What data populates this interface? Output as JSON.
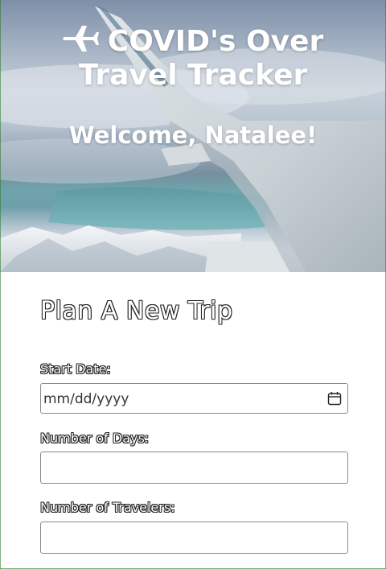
{
  "header": {
    "title_line1": "COVID's Over",
    "title_line2": "Travel Tracker",
    "welcome": "Welcome, Natalee!"
  },
  "form": {
    "heading": "Plan A New Trip",
    "start_date_label": "Start Date:",
    "start_date_placeholder": "mm/dd/yyyy",
    "days_label": "Number of Days:",
    "days_value": "",
    "travelers_label": "Number of Travelers:",
    "travelers_value": ""
  }
}
